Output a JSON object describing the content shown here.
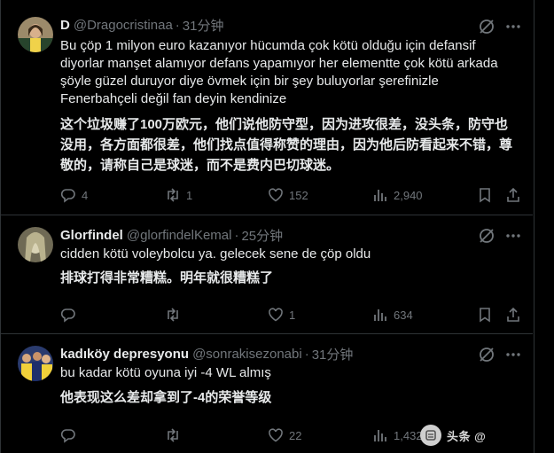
{
  "tweets": [
    {
      "name": "D",
      "handle": "@Dragocristinaa",
      "time": "31分钟",
      "text": "Bu çöp 1 milyon euro kazanıyor hücumda çok kötü olduğu için defansif\ndiyorlar manşet alamıyor defans yapamıyor her elementte çok kötü arkada\nşöyle güzel duruyor diye övmek için bir şey buluyorlar şerefinizle\nFenerbahçeli değil fan deyin kendinize",
      "translation": "这个垃圾赚了100万欧元，他们说他防守型，因为进攻很差，没头条，防守也\n没用，各方面都很差，他们找点值得称赞的理由，因为他后防看起来不错，尊\n敬的，请称自己是球迷，而不是费内巴切球迷。",
      "replies": "4",
      "reposts": "1",
      "likes": "152",
      "views": "2,940"
    },
    {
      "name": "Glorfindel",
      "handle": "@glorfindelKemal",
      "time": "25分钟",
      "text": "cidden kötü voleybolcu ya. gelecek sene de çöp oldu",
      "translation": "排球打得非常糟糕。明年就很糟糕了",
      "replies": "",
      "reposts": "",
      "likes": "1",
      "views": "634"
    },
    {
      "name": "kadıköy depresyonu",
      "handle": "@sonrakisezonabi",
      "time": "31分钟",
      "text": "bu kadar kötü oyuna iyi -4 WL almış",
      "translation": "他表现这么差却拿到了-4的荣誉等级",
      "replies": "",
      "reposts": "",
      "likes": "22",
      "views": "1,432"
    }
  ],
  "separator": "·",
  "watermark": "头条 @        ",
  "colors": {
    "background": "#000000",
    "text": "#e7e9ea",
    "secondary": "#71767b",
    "border": "#2f3336"
  },
  "icons": [
    "grok-icon",
    "more-icon",
    "reply-icon",
    "repost-icon",
    "like-icon",
    "views-icon",
    "bookmark-icon",
    "share-icon"
  ]
}
